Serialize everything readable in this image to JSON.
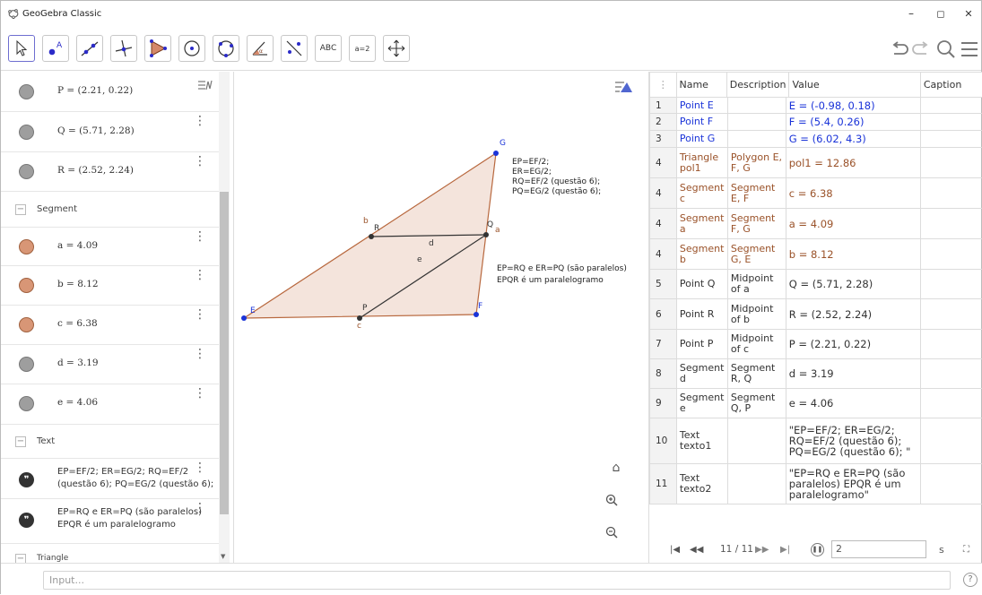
{
  "window": {
    "title": "GeoGebra Classic",
    "minimize": "–",
    "maximize": "◻",
    "close": "✕"
  },
  "toolbar": {
    "text_tool_label": "ABC",
    "slider_tool_label": "a=2"
  },
  "algebra": {
    "items": [
      {
        "type": "point",
        "expr": "P = (2.21, 0.22)",
        "color": "#9e9e9e"
      },
      {
        "type": "point",
        "expr": "Q = (5.71, 2.28)",
        "color": "#9e9e9e"
      },
      {
        "type": "point",
        "expr": "R = (2.52, 2.24)",
        "color": "#9e9e9e"
      }
    ],
    "segment_header": "Segment",
    "segments": [
      {
        "expr": "a = 4.09",
        "color": "#d89676"
      },
      {
        "expr": "b = 8.12",
        "color": "#d89676"
      },
      {
        "expr": "c = 6.38",
        "color": "#d89676"
      },
      {
        "expr": "d = 3.19",
        "color": "#9e9e9e"
      },
      {
        "expr": "e = 4.06",
        "color": "#9e9e9e"
      }
    ],
    "text_header": "Text",
    "texts": [
      {
        "line1": "EP=EF/2; ER=EG/2; RQ=EF/2",
        "line2": "(questão 6); PQ=EG/2 (questão 6);"
      },
      {
        "line1": "EP=RQ e ER=PQ (são paralelos)",
        "line2": "EPQR é um paralelogramo"
      }
    ],
    "triangle_header": "Triangle"
  },
  "graphics": {
    "labels": {
      "E": "E",
      "F": "F",
      "G": "G",
      "P": "P",
      "Q": "Q",
      "R": "R",
      "a": "a",
      "b": "b",
      "c": "c",
      "d": "d",
      "e": "e"
    },
    "text1": [
      "EP=EF/2;",
      "ER=EG/2;",
      "RQ=EF/2 (questão 6);",
      "PQ=EG/2 (questão 6);"
    ],
    "text2": [
      "EP=RQ e ER=PQ (são paralelos)",
      "EPQR é um paralelogramo"
    ],
    "home_icon": "⌂"
  },
  "sheet": {
    "headers": [
      "Name",
      "Description",
      "Value",
      "Caption"
    ],
    "rows": [
      {
        "n": "1",
        "name": "Point E",
        "desc": "",
        "value": "E = (-0.98, 0.18)",
        "cls": "c-blue"
      },
      {
        "n": "2",
        "name": "Point F",
        "desc": "",
        "value": "F = (5.4, 0.26)",
        "cls": "c-blue"
      },
      {
        "n": "3",
        "name": "Point G",
        "desc": "",
        "value": "G = (6.02, 4.3)",
        "cls": "c-blue"
      },
      {
        "n": "4",
        "name": "Triangle pol1",
        "desc": "Polygon E, F, G",
        "value": "pol1 = 12.86",
        "cls": "c-brown"
      },
      {
        "n": "4",
        "name": "Segment c",
        "desc": "Segment E, F",
        "value": "c = 6.38",
        "cls": "c-brown"
      },
      {
        "n": "4",
        "name": "Segment a",
        "desc": "Segment F, G",
        "value": "a = 4.09",
        "cls": "c-brown"
      },
      {
        "n": "4",
        "name": "Segment b",
        "desc": "Segment G, E",
        "value": "b = 8.12",
        "cls": "c-brown"
      },
      {
        "n": "5",
        "name": "Point Q",
        "desc": "Midpoint of a",
        "value": "Q = (5.71, 2.28)",
        "cls": "c-dark"
      },
      {
        "n": "6",
        "name": "Point R",
        "desc": "Midpoint of b",
        "value": "R = (2.52, 2.24)",
        "cls": "c-dark"
      },
      {
        "n": "7",
        "name": "Point P",
        "desc": "Midpoint of c",
        "value": "P = (2.21, 0.22)",
        "cls": "c-dark"
      },
      {
        "n": "8",
        "name": "Segment d",
        "desc": "Segment R, Q",
        "value": "d = 3.19",
        "cls": "c-dark"
      },
      {
        "n": "9",
        "name": "Segment e",
        "desc": "Segment Q, P",
        "value": "e = 4.06",
        "cls": "c-dark"
      },
      {
        "n": "10",
        "name": "Text texto1",
        "desc": "",
        "value": "\"EP=EF/2; ER=EG/2; RQ=EF/2 (questão 6); PQ=EG/2 (questão 6); \"",
        "cls": "c-dark"
      },
      {
        "n": "11",
        "name": "Text texto2",
        "desc": "",
        "value": "\"EP=RQ e ER=PQ (são paralelos) EPQR é um paralelogramo\"",
        "cls": "c-dark"
      }
    ],
    "nav": {
      "position": "11 / 11",
      "step_value": "2",
      "unit": "s"
    }
  },
  "input": {
    "placeholder": "Input...",
    "help": "?"
  }
}
